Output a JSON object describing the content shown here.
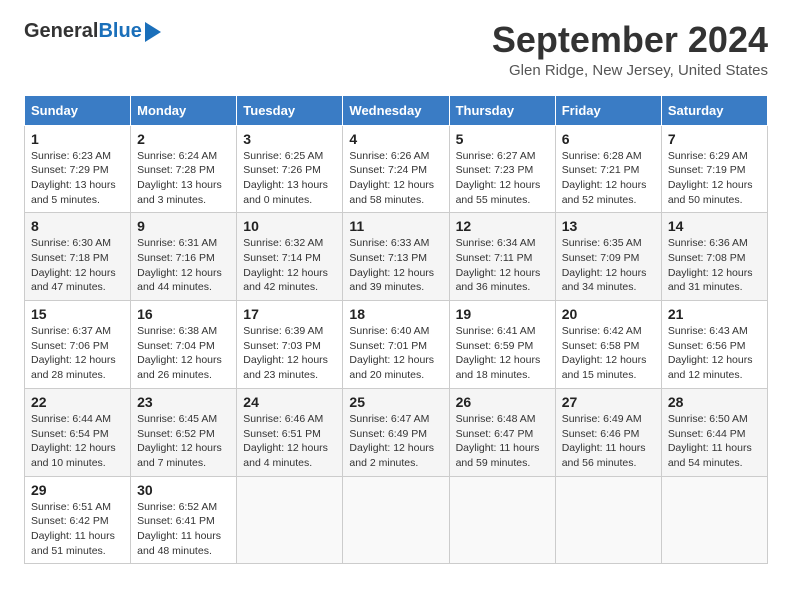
{
  "header": {
    "logo_general": "General",
    "logo_blue": "Blue",
    "month_title": "September 2024",
    "location": "Glen Ridge, New Jersey, United States"
  },
  "calendar": {
    "days_of_week": [
      "Sunday",
      "Monday",
      "Tuesday",
      "Wednesday",
      "Thursday",
      "Friday",
      "Saturday"
    ],
    "weeks": [
      [
        {
          "day": "1",
          "sunrise": "Sunrise: 6:23 AM",
          "sunset": "Sunset: 7:29 PM",
          "daylight": "Daylight: 13 hours and 5 minutes."
        },
        {
          "day": "2",
          "sunrise": "Sunrise: 6:24 AM",
          "sunset": "Sunset: 7:28 PM",
          "daylight": "Daylight: 13 hours and 3 minutes."
        },
        {
          "day": "3",
          "sunrise": "Sunrise: 6:25 AM",
          "sunset": "Sunset: 7:26 PM",
          "daylight": "Daylight: 13 hours and 0 minutes."
        },
        {
          "day": "4",
          "sunrise": "Sunrise: 6:26 AM",
          "sunset": "Sunset: 7:24 PM",
          "daylight": "Daylight: 12 hours and 58 minutes."
        },
        {
          "day": "5",
          "sunrise": "Sunrise: 6:27 AM",
          "sunset": "Sunset: 7:23 PM",
          "daylight": "Daylight: 12 hours and 55 minutes."
        },
        {
          "day": "6",
          "sunrise": "Sunrise: 6:28 AM",
          "sunset": "Sunset: 7:21 PM",
          "daylight": "Daylight: 12 hours and 52 minutes."
        },
        {
          "day": "7",
          "sunrise": "Sunrise: 6:29 AM",
          "sunset": "Sunset: 7:19 PM",
          "daylight": "Daylight: 12 hours and 50 minutes."
        }
      ],
      [
        {
          "day": "8",
          "sunrise": "Sunrise: 6:30 AM",
          "sunset": "Sunset: 7:18 PM",
          "daylight": "Daylight: 12 hours and 47 minutes."
        },
        {
          "day": "9",
          "sunrise": "Sunrise: 6:31 AM",
          "sunset": "Sunset: 7:16 PM",
          "daylight": "Daylight: 12 hours and 44 minutes."
        },
        {
          "day": "10",
          "sunrise": "Sunrise: 6:32 AM",
          "sunset": "Sunset: 7:14 PM",
          "daylight": "Daylight: 12 hours and 42 minutes."
        },
        {
          "day": "11",
          "sunrise": "Sunrise: 6:33 AM",
          "sunset": "Sunset: 7:13 PM",
          "daylight": "Daylight: 12 hours and 39 minutes."
        },
        {
          "day": "12",
          "sunrise": "Sunrise: 6:34 AM",
          "sunset": "Sunset: 7:11 PM",
          "daylight": "Daylight: 12 hours and 36 minutes."
        },
        {
          "day": "13",
          "sunrise": "Sunrise: 6:35 AM",
          "sunset": "Sunset: 7:09 PM",
          "daylight": "Daylight: 12 hours and 34 minutes."
        },
        {
          "day": "14",
          "sunrise": "Sunrise: 6:36 AM",
          "sunset": "Sunset: 7:08 PM",
          "daylight": "Daylight: 12 hours and 31 minutes."
        }
      ],
      [
        {
          "day": "15",
          "sunrise": "Sunrise: 6:37 AM",
          "sunset": "Sunset: 7:06 PM",
          "daylight": "Daylight: 12 hours and 28 minutes."
        },
        {
          "day": "16",
          "sunrise": "Sunrise: 6:38 AM",
          "sunset": "Sunset: 7:04 PM",
          "daylight": "Daylight: 12 hours and 26 minutes."
        },
        {
          "day": "17",
          "sunrise": "Sunrise: 6:39 AM",
          "sunset": "Sunset: 7:03 PM",
          "daylight": "Daylight: 12 hours and 23 minutes."
        },
        {
          "day": "18",
          "sunrise": "Sunrise: 6:40 AM",
          "sunset": "Sunset: 7:01 PM",
          "daylight": "Daylight: 12 hours and 20 minutes."
        },
        {
          "day": "19",
          "sunrise": "Sunrise: 6:41 AM",
          "sunset": "Sunset: 6:59 PM",
          "daylight": "Daylight: 12 hours and 18 minutes."
        },
        {
          "day": "20",
          "sunrise": "Sunrise: 6:42 AM",
          "sunset": "Sunset: 6:58 PM",
          "daylight": "Daylight: 12 hours and 15 minutes."
        },
        {
          "day": "21",
          "sunrise": "Sunrise: 6:43 AM",
          "sunset": "Sunset: 6:56 PM",
          "daylight": "Daylight: 12 hours and 12 minutes."
        }
      ],
      [
        {
          "day": "22",
          "sunrise": "Sunrise: 6:44 AM",
          "sunset": "Sunset: 6:54 PM",
          "daylight": "Daylight: 12 hours and 10 minutes."
        },
        {
          "day": "23",
          "sunrise": "Sunrise: 6:45 AM",
          "sunset": "Sunset: 6:52 PM",
          "daylight": "Daylight: 12 hours and 7 minutes."
        },
        {
          "day": "24",
          "sunrise": "Sunrise: 6:46 AM",
          "sunset": "Sunset: 6:51 PM",
          "daylight": "Daylight: 12 hours and 4 minutes."
        },
        {
          "day": "25",
          "sunrise": "Sunrise: 6:47 AM",
          "sunset": "Sunset: 6:49 PM",
          "daylight": "Daylight: 12 hours and 2 minutes."
        },
        {
          "day": "26",
          "sunrise": "Sunrise: 6:48 AM",
          "sunset": "Sunset: 6:47 PM",
          "daylight": "Daylight: 11 hours and 59 minutes."
        },
        {
          "day": "27",
          "sunrise": "Sunrise: 6:49 AM",
          "sunset": "Sunset: 6:46 PM",
          "daylight": "Daylight: 11 hours and 56 minutes."
        },
        {
          "day": "28",
          "sunrise": "Sunrise: 6:50 AM",
          "sunset": "Sunset: 6:44 PM",
          "daylight": "Daylight: 11 hours and 54 minutes."
        }
      ],
      [
        {
          "day": "29",
          "sunrise": "Sunrise: 6:51 AM",
          "sunset": "Sunset: 6:42 PM",
          "daylight": "Daylight: 11 hours and 51 minutes."
        },
        {
          "day": "30",
          "sunrise": "Sunrise: 6:52 AM",
          "sunset": "Sunset: 6:41 PM",
          "daylight": "Daylight: 11 hours and 48 minutes."
        },
        null,
        null,
        null,
        null,
        null
      ]
    ]
  }
}
